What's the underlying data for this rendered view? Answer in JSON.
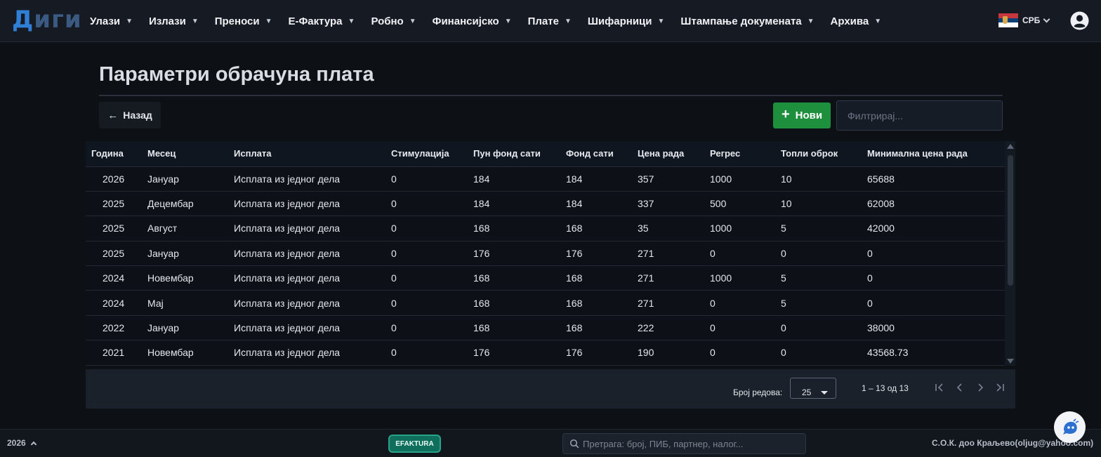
{
  "app": {
    "logo_part1": "Д",
    "logo_part2": "иги"
  },
  "nav": {
    "items": [
      {
        "label": "Улази"
      },
      {
        "label": "Излази"
      },
      {
        "label": "Преноси"
      },
      {
        "label": "Е-Фактура"
      },
      {
        "label": "Робно"
      },
      {
        "label": "Финансијско"
      },
      {
        "label": "Плате"
      },
      {
        "label": "Шифарници"
      },
      {
        "label": "Штампање докумената"
      },
      {
        "label": "Архива"
      }
    ],
    "caret_icon": "caret-down-icon",
    "language": "СРБ",
    "flag_icon": "serbia-flag-icon",
    "user_icon": "user-account-icon"
  },
  "page": {
    "title": "Параметри обрачуна плата",
    "back_label": "Назад",
    "new_label": "Нови",
    "filter_placeholder": "Филтрирај...",
    "filter_value": ""
  },
  "table": {
    "columns": [
      "Година",
      "Месец",
      "Исплата",
      "Стимулација",
      "Пун фонд сати",
      "Фонд сати",
      "Цена рада",
      "Регрес",
      "Топли оброк",
      "Минимална цена рада"
    ],
    "rows": [
      [
        "2026",
        "Јануар",
        "Исплата из једног дела",
        "0",
        "184",
        "184",
        "357",
        "1000",
        "10",
        "65688"
      ],
      [
        "2025",
        "Децембар",
        "Исплата из једног дела",
        "0",
        "184",
        "184",
        "337",
        "500",
        "10",
        "62008"
      ],
      [
        "2025",
        "Август",
        "Исплата из једног дела",
        "0",
        "168",
        "168",
        "35",
        "1000",
        "5",
        "42000"
      ],
      [
        "2025",
        "Јануар",
        "Исплата из једног дела",
        "0",
        "176",
        "176",
        "271",
        "0",
        "0",
        "0"
      ],
      [
        "2024",
        "Новембар",
        "Исплата из једног дела",
        "0",
        "168",
        "168",
        "271",
        "1000",
        "5",
        "0"
      ],
      [
        "2024",
        "Мај",
        "Исплата из једног дела",
        "0",
        "168",
        "168",
        "271",
        "0",
        "5",
        "0"
      ],
      [
        "2022",
        "Јануар",
        "Исплата из једног дела",
        "0",
        "168",
        "168",
        "222",
        "0",
        "0",
        "38000"
      ],
      [
        "2021",
        "Новембар",
        "Исплата из једног дела",
        "0",
        "176",
        "176",
        "190",
        "0",
        "0",
        "43568.73"
      ]
    ]
  },
  "pagination": {
    "rows_label": "Број редова:",
    "rows_per_page": "25",
    "range": "1 – 13 од 13"
  },
  "status": {
    "year": "2026",
    "efaktura_badge": "EFAKTURA",
    "search_placeholder": "Претрага: број, ПИБ, партнер, налог...",
    "company": "С.О.К. доо Краљево(oljug@yahoo.com)"
  },
  "colors": {
    "accent_green": "#1e8f3c",
    "logo_blue": "#2f7fd6",
    "efaktura_teal": "#0f6e5c"
  }
}
